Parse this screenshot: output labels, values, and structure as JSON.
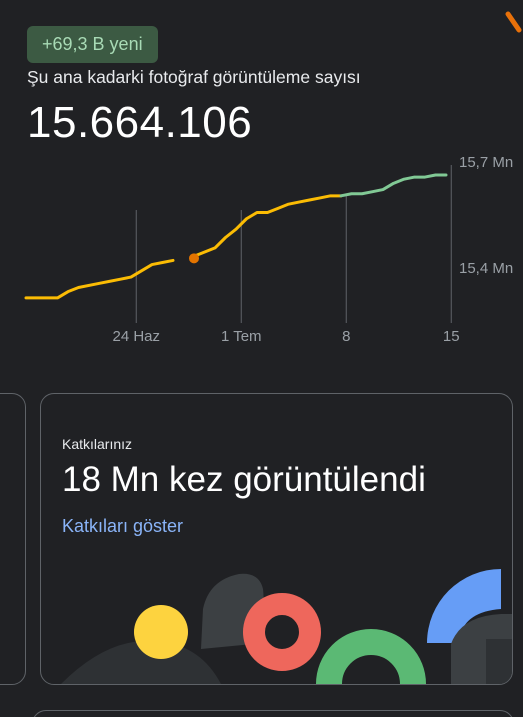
{
  "header": {
    "badge": "+69,3 B yeni",
    "subtitle": "Şu ana kadarki fotoğraf görüntüleme sayısı",
    "count": "15.664.106"
  },
  "chart_data": {
    "type": "line",
    "x_ticks": [
      "24 Haz",
      "1 Tem",
      "8",
      "15"
    ],
    "y_ticks": [
      "15,7 Mn",
      "15,4 Mn"
    ],
    "ylim": [
      15.1,
      15.7
    ],
    "series": [
      {
        "color": "#fbbc04",
        "points": [
          [
            0,
            15.11
          ],
          [
            3,
            15.11
          ],
          [
            4,
            15.14
          ],
          [
            5,
            15.16
          ],
          [
            7,
            15.18
          ],
          [
            8,
            15.19
          ],
          [
            9,
            15.2
          ],
          [
            10,
            15.21
          ],
          [
            11,
            15.24
          ],
          [
            12,
            15.27
          ],
          [
            13,
            15.28
          ],
          [
            14,
            15.29
          ]
        ]
      },
      {
        "color": "#fbbc04",
        "points": [
          [
            16,
            15.31
          ],
          [
            18,
            15.35
          ],
          [
            19,
            15.4
          ],
          [
            20,
            15.44
          ],
          [
            21,
            15.49
          ],
          [
            22,
            15.52
          ],
          [
            23,
            15.52
          ],
          [
            24,
            15.54
          ],
          [
            25,
            15.56
          ],
          [
            26,
            15.57
          ],
          [
            27,
            15.58
          ],
          [
            28,
            15.59
          ],
          [
            29,
            15.6
          ],
          [
            30,
            15.6
          ]
        ]
      },
      {
        "color": "#81c995",
        "points": [
          [
            30,
            15.6
          ],
          [
            31,
            15.61
          ],
          [
            32,
            15.61
          ],
          [
            33,
            15.62
          ],
          [
            34,
            15.63
          ],
          [
            35,
            15.66
          ],
          [
            36,
            15.68
          ],
          [
            37,
            15.69
          ],
          [
            38,
            15.69
          ],
          [
            39,
            15.7
          ],
          [
            40,
            15.7
          ]
        ]
      }
    ],
    "marker": {
      "x": 16,
      "y": 15.3,
      "color": "#e37400"
    }
  },
  "card": {
    "label": "Katkılarınız",
    "title": "18 Mn kez görüntülendi",
    "link": "Katkıları göster"
  }
}
